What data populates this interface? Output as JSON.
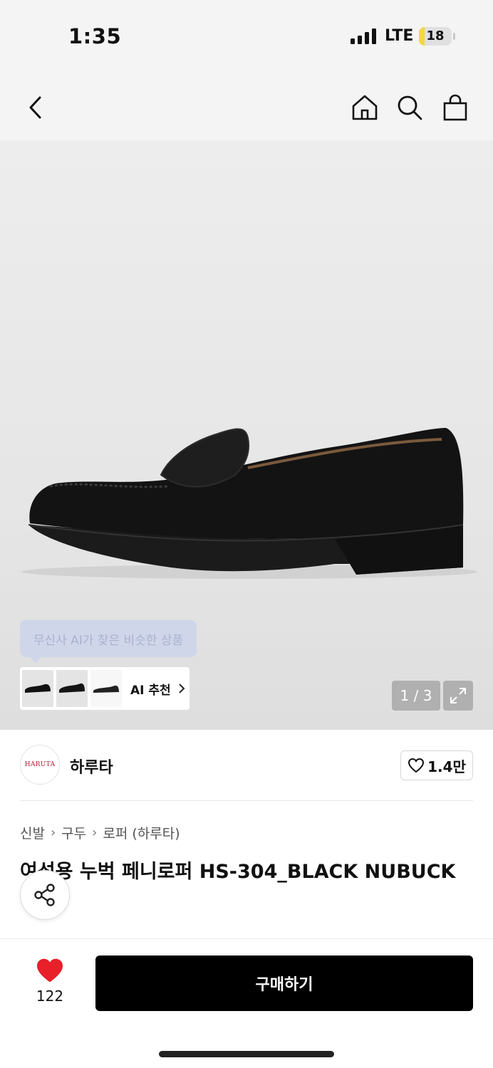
{
  "status_bar": {
    "time": "1:35",
    "network": "LTE",
    "battery": "18",
    "battery_level": 0.18
  },
  "nav": {
    "back_icon": "chevron-left-icon",
    "home_icon": "home-icon",
    "search_icon": "search-icon",
    "cart_icon": "shopping-bag-icon"
  },
  "gallery": {
    "ai_tooltip": "무신사 AI가 찾은 비슷한 상품",
    "ai_label": "AI 추천",
    "counter": "1 / 3",
    "expand_icon": "expand-icon"
  },
  "brand": {
    "logo_text": "HARUTA",
    "name": "하루타",
    "like_count": "1.4만"
  },
  "breadcrumb": [
    "신발",
    "구두",
    "로퍼 (하루타)"
  ],
  "product": {
    "title": "여성용 누벅 페니로퍼 HS-304_BLACK NUBUCK"
  },
  "bottom_bar": {
    "like_count": "122",
    "buy_label": "구매하기"
  },
  "colors": {
    "accent": "#000000",
    "like_heart": "#e8202a",
    "tooltip_bg": "#cfd6ea"
  }
}
